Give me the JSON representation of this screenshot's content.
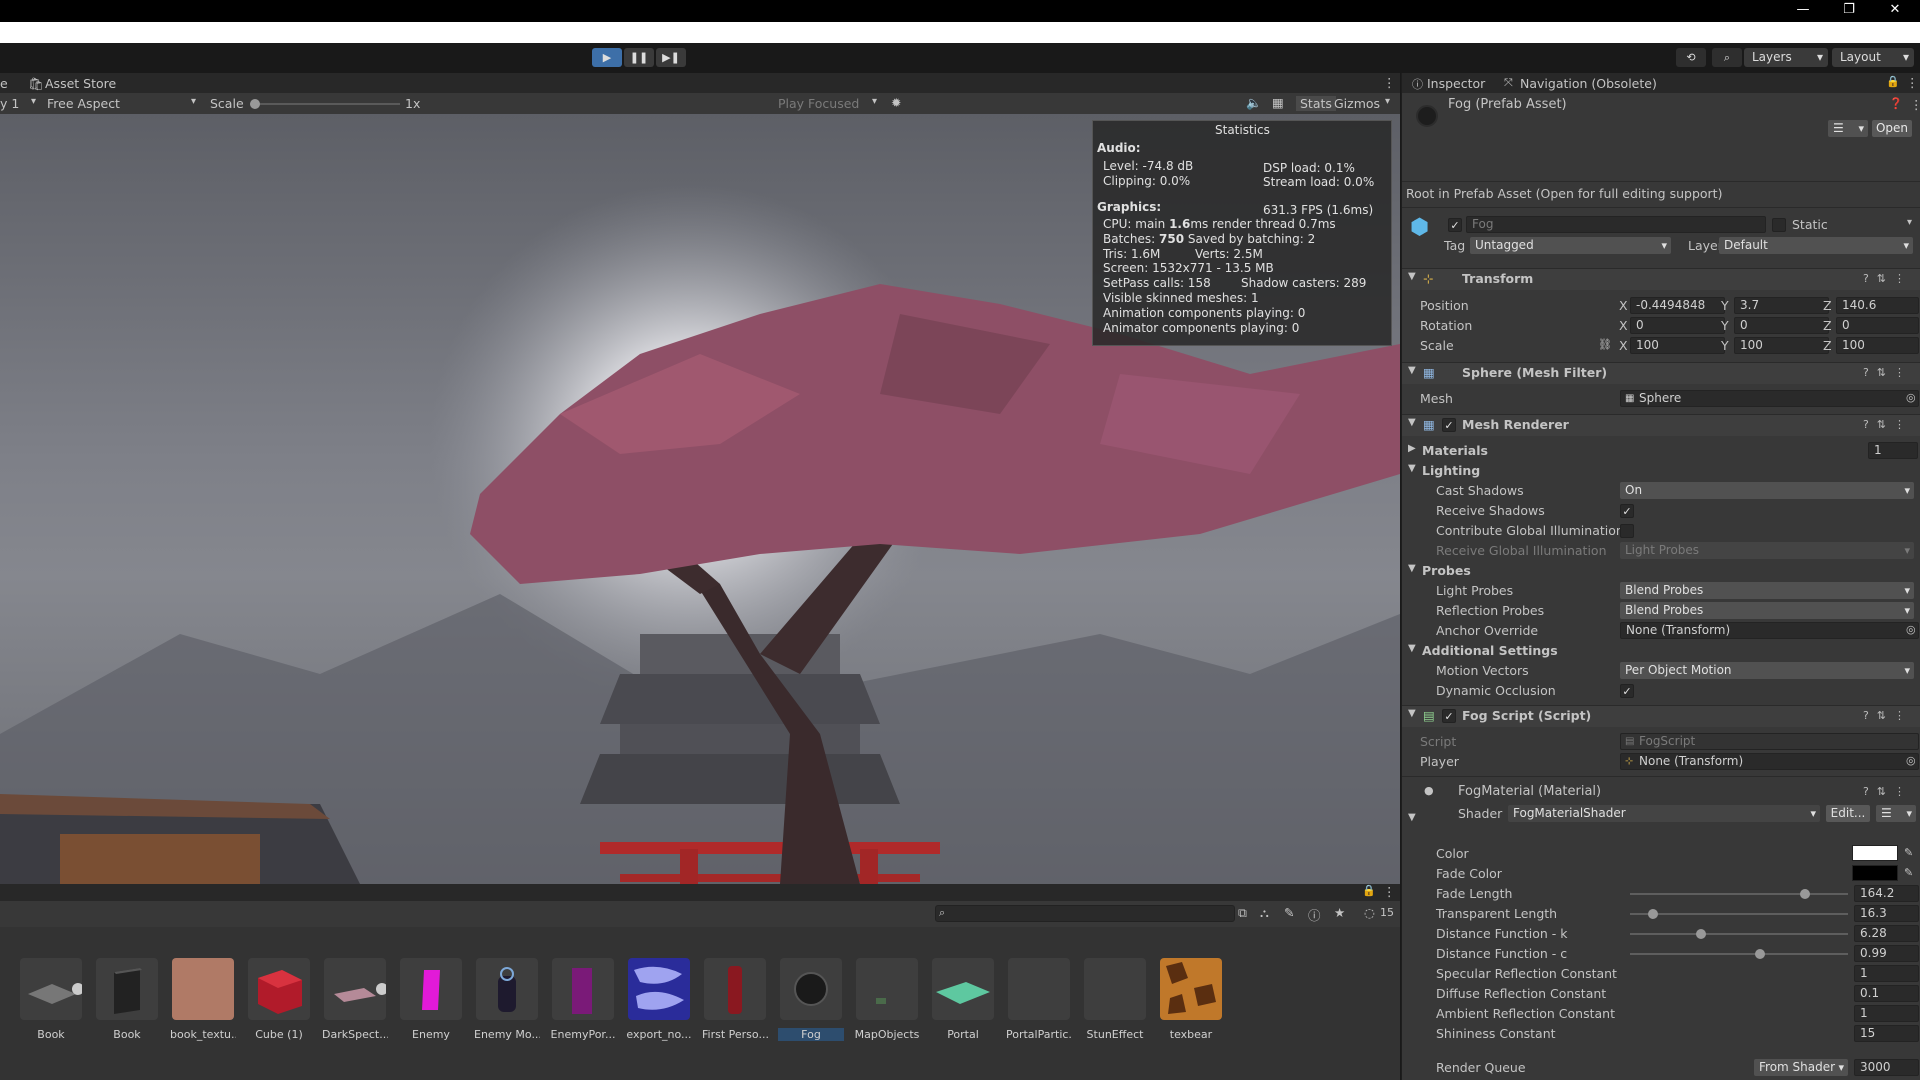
{
  "window": {
    "minimize": "—",
    "restore": "❐",
    "close": "✕"
  },
  "toolbar": {
    "play": "▶",
    "pause": "❚❚",
    "step": "▶❚",
    "layers": "Layers",
    "layout": "Layout"
  },
  "scene_tabs": {
    "prev_tab": "e",
    "asset_store": "Asset Store"
  },
  "game_toolbar": {
    "display": "y 1",
    "aspect": "Free Aspect",
    "scale_label": "Scale",
    "scale_value": "1x",
    "play_focused": "Play Focused",
    "stats": "Stats",
    "gizmos": "Gizmos"
  },
  "stats": {
    "title": "Statistics",
    "audio_label": "Audio:",
    "level": "Level: -74.8 dB",
    "dsp": "DSP load: 0.1%",
    "clipping": "Clipping: 0.0%",
    "stream": "Stream load: 0.0%",
    "graphics_label": "Graphics:",
    "fps": "631.3 FPS (1.6ms)",
    "cpu_a": "CPU: main ",
    "cpu_main": "1.6",
    "cpu_b": "ms  render thread 0.7ms",
    "batches_a": "Batches: ",
    "batches": "750",
    "batches_b": "   Saved by batching: 2",
    "tris": "Tris: 1.6M",
    "verts": "Verts: 2.5M",
    "screen": "Screen: 1532x771 - 13.5 MB",
    "setpass": "SetPass calls: 158",
    "shadow": "Shadow casters: 289",
    "skinned": "Visible skinned meshes: 1",
    "anim": "Animation components playing: 0",
    "animator": "Animator components playing: 0"
  },
  "project": {
    "layer_count": "15",
    "assets": [
      "Book",
      "Book",
      "book_textu...",
      "Cube (1)",
      "DarkSpect...",
      "Enemy",
      "Enemy Mo...",
      "EnemyPor...",
      "export_no...",
      "First Perso...",
      "Fog",
      "MapObjects",
      "Portal",
      "PortalPartic...",
      "StunEffect",
      "texbear"
    ]
  },
  "inspector": {
    "tab_inspector": "Inspector",
    "tab_navigation": "Navigation (Obsolete)",
    "prefab_title": "Fog (Prefab Asset)",
    "open_button": "Open",
    "root_note": "Root in Prefab Asset (Open for full editing support)",
    "name": "Fog",
    "static_label": "Static",
    "tag_label": "Tag",
    "tag_value": "Untagged",
    "layer_label": "Layer",
    "layer_value": "Default",
    "transform": {
      "title": "Transform",
      "position_label": "Position",
      "rotation_label": "Rotation",
      "scale_label": "Scale",
      "px": "-0.4494848",
      "py": "3.7",
      "pz": "140.6",
      "rx": "0",
      "ry": "0",
      "rz": "0",
      "sx": "100",
      "sy": "100",
      "sz": "100"
    },
    "mesh_filter": {
      "title": "Sphere (Mesh Filter)",
      "mesh_label": "Mesh",
      "mesh_value": "Sphere"
    },
    "mesh_renderer": {
      "title": "Mesh Renderer",
      "materials_label": "Materials",
      "materials_count": "1",
      "lighting_label": "Lighting",
      "cast_shadows_label": "Cast Shadows",
      "cast_shadows_value": "On",
      "receive_shadows_label": "Receive Shadows",
      "contribute_gi_label": "Contribute Global Illumination",
      "receive_gi_label": "Receive Global Illumination",
      "receive_gi_value": "Light Probes",
      "probes_label": "Probes",
      "light_probes_label": "Light Probes",
      "light_probes_value": "Blend Probes",
      "reflection_probes_label": "Reflection Probes",
      "reflection_probes_value": "Blend Probes",
      "anchor_label": "Anchor Override",
      "anchor_value": "None (Transform)",
      "additional_label": "Additional Settings",
      "motion_vectors_label": "Motion Vectors",
      "motion_vectors_value": "Per Object Motion",
      "dynamic_occlusion_label": "Dynamic Occlusion"
    },
    "fog_script": {
      "title": "Fog Script (Script)",
      "script_label": "Script",
      "script_value": "FogScript",
      "player_label": "Player",
      "player_value": "None (Transform)"
    },
    "material": {
      "title": "FogMaterial (Material)",
      "shader_label": "Shader",
      "shader_value": "FogMaterialShader",
      "edit_button": "Edit...",
      "color_label": "Color",
      "fade_color_label": "Fade Color",
      "fade_length_label": "Fade Length",
      "fade_length": "164.2",
      "transparent_length_label": "Transparent Length",
      "transparent_length": "16.3",
      "dist_k_label": "Distance Function - k",
      "dist_k": "6.28",
      "dist_c_label": "Distance Function - c",
      "dist_c": "0.99",
      "spec_label": "Specular Reflection Constant",
      "spec": "1",
      "diffuse_label": "Diffuse Reflection Constant",
      "diffuse": "0.1",
      "ambient_label": "Ambient Reflection Constant",
      "ambient": "1",
      "shininess_label": "Shininess Constant",
      "shininess": "15",
      "queue_label": "Render Queue",
      "queue_mode": "From Shader",
      "queue_value": "3000"
    }
  }
}
